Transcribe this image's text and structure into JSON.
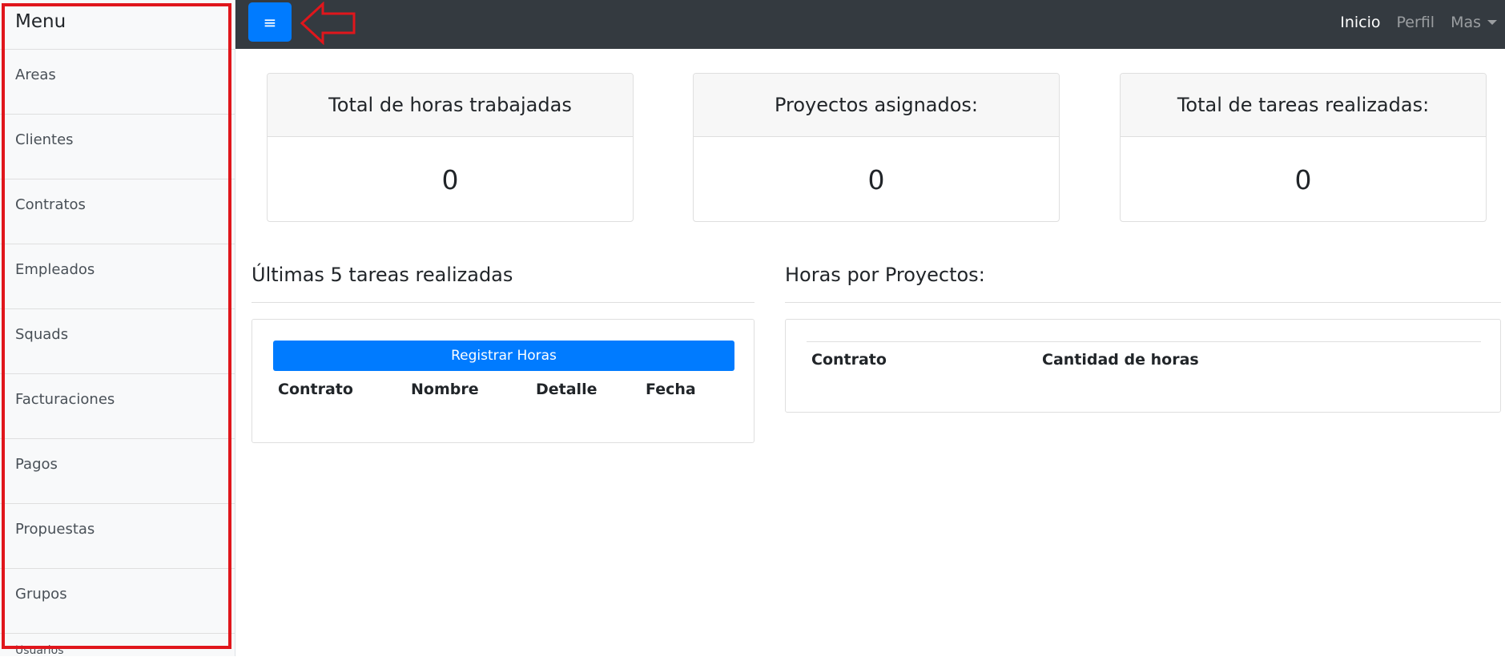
{
  "sidebar": {
    "title": "Menu",
    "items": [
      {
        "label": "Areas"
      },
      {
        "label": "Clientes"
      },
      {
        "label": "Contratos"
      },
      {
        "label": "Empleados"
      },
      {
        "label": "Squads"
      },
      {
        "label": "Facturaciones"
      },
      {
        "label": "Pagos"
      },
      {
        "label": "Propuestas"
      },
      {
        "label": "Grupos"
      }
    ],
    "partial_item": "Usuarios"
  },
  "navbar": {
    "toggle_icon": "hamburger-icon",
    "toggle_glyph": "≡",
    "links": [
      {
        "label": "Inicio",
        "active": true
      },
      {
        "label": "Perfil",
        "active": false
      },
      {
        "label": "Mas",
        "active": false
      }
    ]
  },
  "stats": [
    {
      "title": "Total de horas trabajadas",
      "value": "0"
    },
    {
      "title": "Proyectos asignados:",
      "value": "0"
    },
    {
      "title": "Total de tareas realizadas:",
      "value": "0"
    }
  ],
  "tasks_section": {
    "title": "Últimas 5 tareas realizadas",
    "button_label": "Registrar Horas",
    "columns": [
      "Contrato",
      "Nombre",
      "Detalle",
      "Fecha"
    ]
  },
  "projects_section": {
    "title": "Horas por Proyectos:",
    "columns": [
      "Contrato",
      "Cantidad de horas"
    ]
  },
  "colors": {
    "accent": "#007bff",
    "navbar": "#343a40",
    "annotation": "#e0161c"
  }
}
